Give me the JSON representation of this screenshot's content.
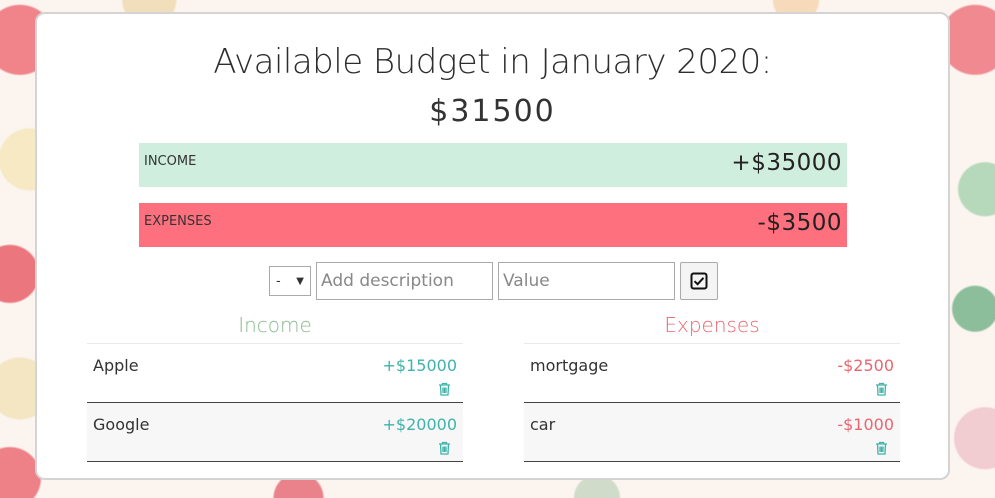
{
  "header": {
    "title": "Available Budget in January 2020:",
    "total": "$31500"
  },
  "summary": {
    "income": {
      "label": "INCOME",
      "amount": "+$35000"
    },
    "expenses": {
      "label": "EXPENSES",
      "amount": "-$3500"
    }
  },
  "form": {
    "type_selected": "-",
    "description_placeholder": "Add description",
    "value_placeholder": "Value"
  },
  "income": {
    "heading": "Income",
    "items": [
      {
        "description": "Apple",
        "value": "+$15000"
      },
      {
        "description": "Google",
        "value": "+$20000"
      }
    ]
  },
  "expenses": {
    "heading": "Expenses",
    "items": [
      {
        "description": "mortgage",
        "value": "-$2500"
      },
      {
        "description": "car",
        "value": "-$1000"
      }
    ]
  },
  "colors": {
    "income_bar": "#cfeedd",
    "expense_bar": "#ff707e",
    "income_text": "#3fb3ab",
    "expense_text": "#e8666f"
  },
  "icons": {
    "add": "check-box-icon",
    "delete": "trash-icon"
  }
}
